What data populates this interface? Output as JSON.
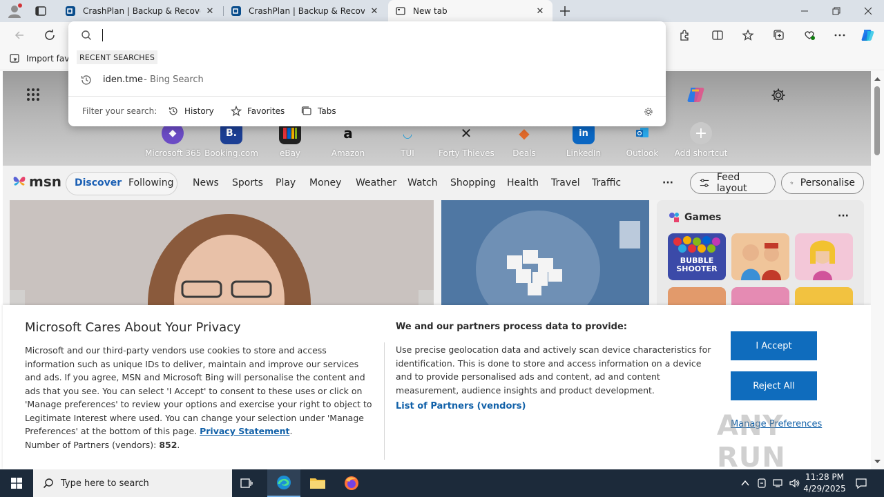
{
  "tabs": [
    {
      "title": "CrashPlan | Backup & Recovery S",
      "active": false
    },
    {
      "title": "CrashPlan | Backup & Recovery S",
      "active": false
    },
    {
      "title": "New tab",
      "active": true
    }
  ],
  "favorites_bar": {
    "import_label": "Import favo"
  },
  "omnibox": {
    "query": "",
    "recent_header": "RECENT SEARCHES",
    "recent_items": [
      {
        "query": "iden.tme",
        "source": " - Bing Search"
      }
    ],
    "filter_label": "Filter your search:",
    "filters": [
      "History",
      "Favorites",
      "Tabs"
    ]
  },
  "shortcuts": [
    {
      "label": "Microsoft 365",
      "icon": "microsoft-365-icon",
      "color": "#6b4bc4"
    },
    {
      "label": "Booking.com",
      "icon": "booking-icon",
      "color": "#1c3f94"
    },
    {
      "label": "eBay",
      "icon": "ebay-icon",
      "color": "#e53238"
    },
    {
      "label": "Amazon",
      "icon": "amazon-icon",
      "color": "#ffffff"
    },
    {
      "label": "TUI",
      "icon": "tui-icon",
      "color": "#1a9ad6"
    },
    {
      "label": "Forty Thieves",
      "icon": "forty-thieves-icon",
      "color": "#1f1f1f"
    },
    {
      "label": "Deals",
      "icon": "deals-icon",
      "color": "#e06a2c"
    },
    {
      "label": "LinkedIn",
      "icon": "linkedin-icon",
      "color": "#0a66c2"
    },
    {
      "label": "Outlook",
      "icon": "outlook-icon",
      "color": "#0f6cbd"
    },
    {
      "label": "Add shortcut",
      "icon": "plus-icon",
      "color": "#e6e6e6"
    }
  ],
  "msn": {
    "logo": "msn",
    "tabs": [
      "Discover",
      "Following"
    ],
    "nav": [
      "News",
      "Sports",
      "Play",
      "Money",
      "Weather",
      "Watch",
      "Shopping",
      "Health",
      "Travel",
      "Traffic"
    ],
    "more": "···",
    "feed_layout": "Feed layout",
    "personalise": "Personalise",
    "games_title": "Games",
    "games_more": "···",
    "game_thumb_text": "BUBBLE SHOOTER"
  },
  "consent": {
    "title": "Microsoft Cares About Your Privacy",
    "body": "Microsoft and our third-party vendors use cookies to store and access information such as unique IDs to deliver, maintain and improve our services and ads. If you agree, MSN and Microsoft Bing will personalise the content and ads that you see. You can select 'I Accept' to consent to these uses or click on 'Manage preferences' to review your options and exercise your right to object to Legitimate Interest where used.  You can change your selection under 'Manage Preferences' at the bottom of this page. ",
    "privacy_link": "Privacy Statement",
    "period": ".",
    "partners_label": "Number of Partners (vendors): ",
    "partners_count": "852",
    "partners_suffix": ".",
    "purpose_title": "We and our partners process data to provide:",
    "purpose_body": "Use precise geolocation data and actively scan device characteristics for identification. This is done to store and access information on a device and to provide personalised ads and content, ad and content measurement, audience insights and product development.",
    "partners_link": "List of Partners (vendors)",
    "accept": "I Accept",
    "reject": "Reject All",
    "manage": "Manage Preferences"
  },
  "taskbar": {
    "search_placeholder": "Type here to search",
    "time": "11:28 PM",
    "date": "4/29/2025"
  },
  "watermark": "ANY RUN",
  "colors": {
    "accent": "#0f6cbd",
    "link": "#1060a8",
    "taskbar": "#1c2a3a",
    "tabstrip": "#dbe1e8"
  }
}
